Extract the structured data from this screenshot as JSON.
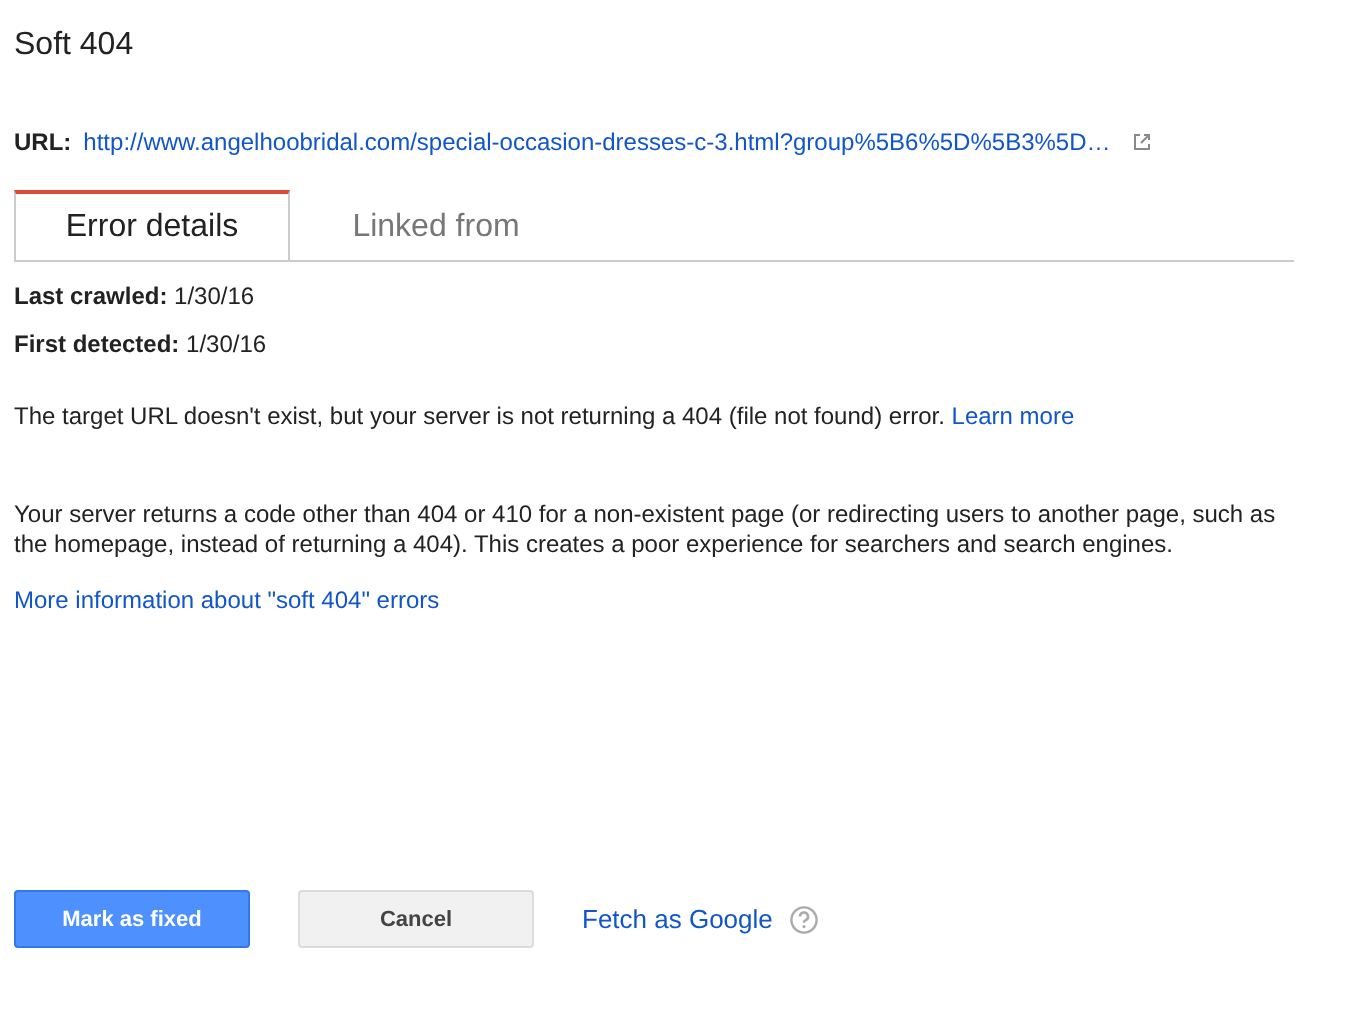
{
  "title": "Soft 404",
  "url": {
    "label": "URL:",
    "value": "http://www.angelhoobridal.com/special-occasion-dresses-c-3.html?group%5B6%5D%5B3%5D…"
  },
  "tabs": [
    {
      "label": "Error details",
      "selected": true
    },
    {
      "label": "Linked from",
      "selected": false
    }
  ],
  "details": [
    "**Last crawled:** 1/30/16",
    "**First detected:** 1/30/16"
  ],
  "summary": {
    "text": "The target URL doesn't exist, but your server is not returning a 404 (file not found) error.",
    "link": "Learn more"
  },
  "explanation": "Your server returns a code other than 404 or 410 for a non-existent page (or redirecting users to another page, such as the homepage, instead of returning a 404). This creates a poor experience for searchers and search engines.",
  "more_link": "More information about \"soft 404\" errors",
  "buttons": [
    {
      "label": "Mark as fixed",
      "kind": "primary"
    },
    {
      "label": "Cancel",
      "kind": "secondary"
    }
  ],
  "fetch_link": "Fetch as Google"
}
